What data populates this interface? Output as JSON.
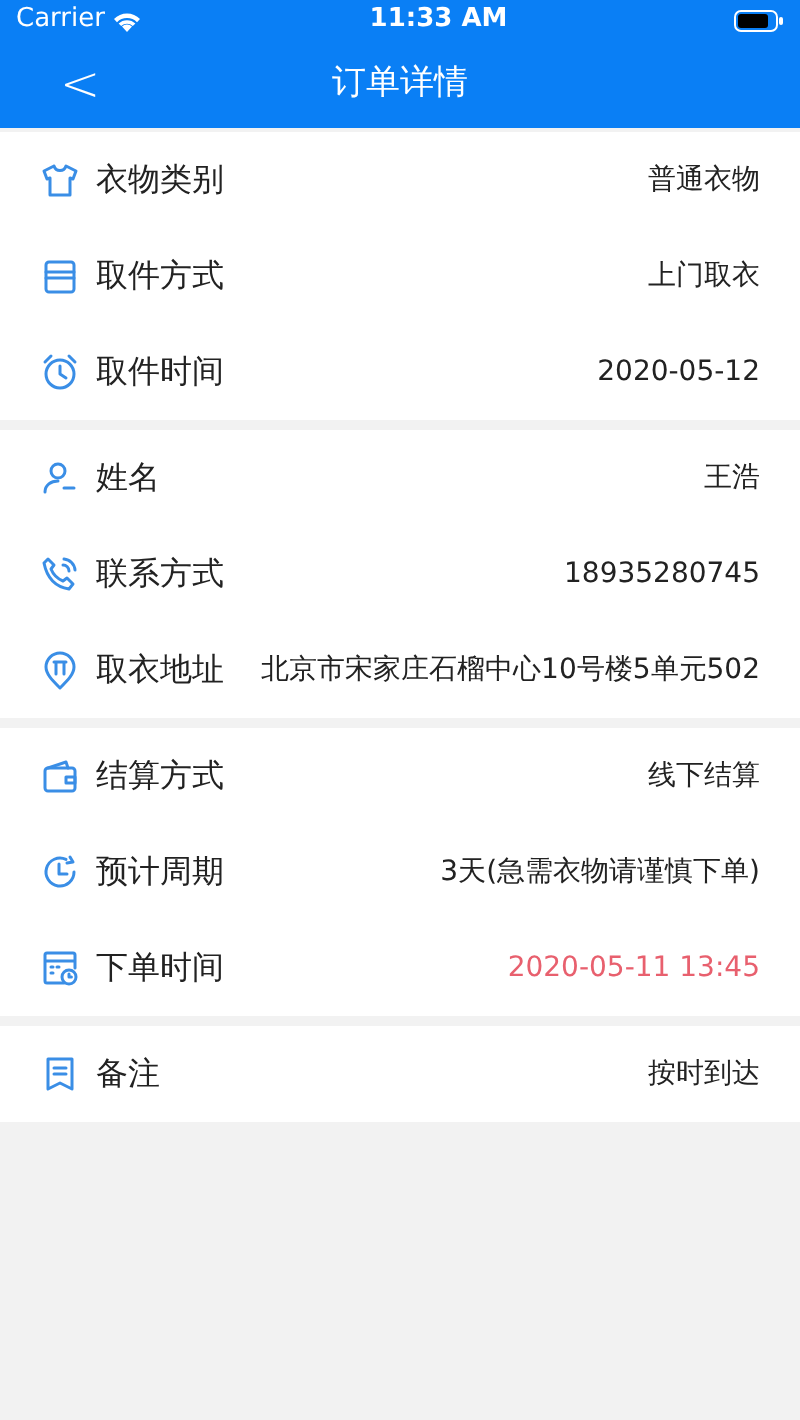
{
  "status_bar": {
    "carrier": "Carrier",
    "time": "11:33 AM"
  },
  "nav": {
    "back": "<",
    "title": "订单详情"
  },
  "groups": [
    {
      "rows": [
        {
          "label": "衣物类别",
          "value": "普通衣物",
          "highlighted": false
        },
        {
          "label": "取件方式",
          "value": "上门取衣",
          "highlighted": false
        },
        {
          "label": "取件时间",
          "value": "2020-05-12",
          "highlighted": false
        }
      ]
    },
    {
      "rows": [
        {
          "label": "姓名",
          "value": "王浩",
          "highlighted": false
        },
        {
          "label": "联系方式",
          "value": "18935280745",
          "highlighted": false
        },
        {
          "label": "取衣地址",
          "value": "北京市宋家庄石榴中心10号楼5单元502",
          "highlighted": false
        }
      ]
    },
    {
      "rows": [
        {
          "label": "结算方式",
          "value": "线下结算",
          "highlighted": false
        },
        {
          "label": "预计周期",
          "value": "3天(急需衣物请谨慎下单)",
          "highlighted": false
        },
        {
          "label": "下单时间",
          "value": "2020-05-11 13:45",
          "highlighted": true
        }
      ]
    },
    {
      "rows": [
        {
          "label": "备注",
          "value": "按时到达",
          "highlighted": false
        }
      ]
    }
  ]
}
